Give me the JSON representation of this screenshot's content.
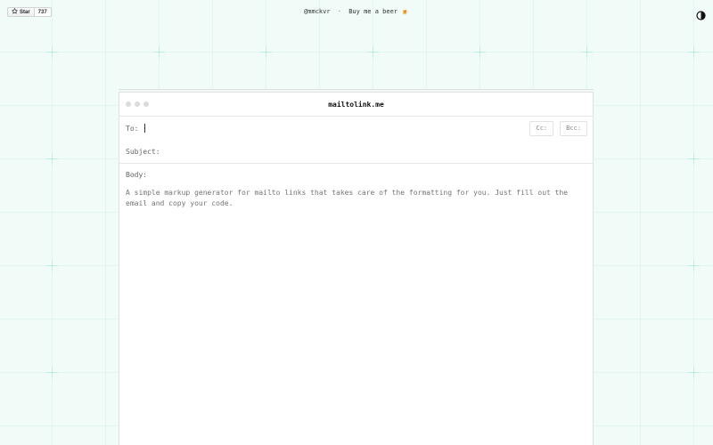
{
  "topbar": {
    "github": {
      "star_label": "Star",
      "star_count": "737",
      "icon": "star-icon"
    },
    "author": "@mmckvr",
    "separator": "·",
    "beer_label": "Buy me a beer 🍺",
    "theme_icon": "contrast-icon"
  },
  "window": {
    "title": "mailtolink.me",
    "to_label": "To:",
    "to_value": "",
    "cc_label": "Cc:",
    "bcc_label": "Bcc:",
    "subject_label": "Subject:",
    "subject_value": "",
    "body_label": "Body:",
    "body_placeholder": "A simple markup generator for mailto links that takes care of the formatting for you. Just fill out the email and copy your code."
  },
  "colors": {
    "background": "#f1fcf9",
    "grid_cross": "#bfeede",
    "window_border": "#dde3e1"
  }
}
